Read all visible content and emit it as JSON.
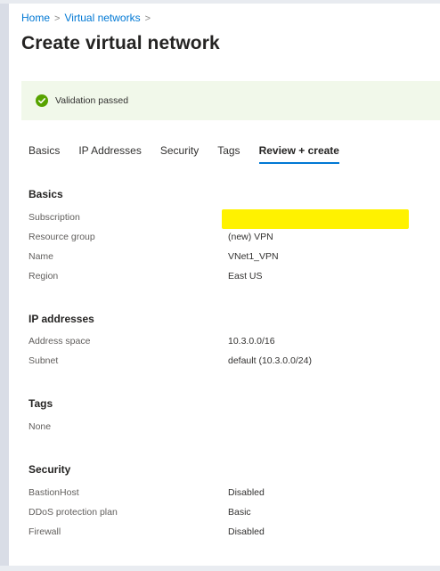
{
  "breadcrumb": {
    "items": [
      "Home",
      "Virtual networks"
    ],
    "separator": ">"
  },
  "page_title": "Create virtual network",
  "validation": {
    "message": "Validation passed",
    "icon": "check-circle-icon",
    "color": "#57a300"
  },
  "tabs": [
    {
      "label": "Basics",
      "active": false
    },
    {
      "label": "IP Addresses",
      "active": false
    },
    {
      "label": "Security",
      "active": false
    },
    {
      "label": "Tags",
      "active": false
    },
    {
      "label": "Review + create",
      "active": true
    }
  ],
  "accent_color": "#0078d4",
  "sections": {
    "basics": {
      "title": "Basics",
      "rows": [
        {
          "label": "Subscription",
          "value": "",
          "redacted": true
        },
        {
          "label": "Resource group",
          "value": "(new) VPN"
        },
        {
          "label": "Name",
          "value": "VNet1_VPN"
        },
        {
          "label": "Region",
          "value": "East US"
        }
      ]
    },
    "ip_addresses": {
      "title": "IP addresses",
      "rows": [
        {
          "label": "Address space",
          "value": "10.3.0.0/16"
        },
        {
          "label": "Subnet",
          "value": "default (10.3.0.0/24)"
        }
      ]
    },
    "tags": {
      "title": "Tags",
      "none_label": "None"
    },
    "security": {
      "title": "Security",
      "rows": [
        {
          "label": "BastionHost",
          "value": "Disabled"
        },
        {
          "label": "DDoS protection plan",
          "value": "Basic"
        },
        {
          "label": "Firewall",
          "value": "Disabled"
        }
      ]
    }
  }
}
